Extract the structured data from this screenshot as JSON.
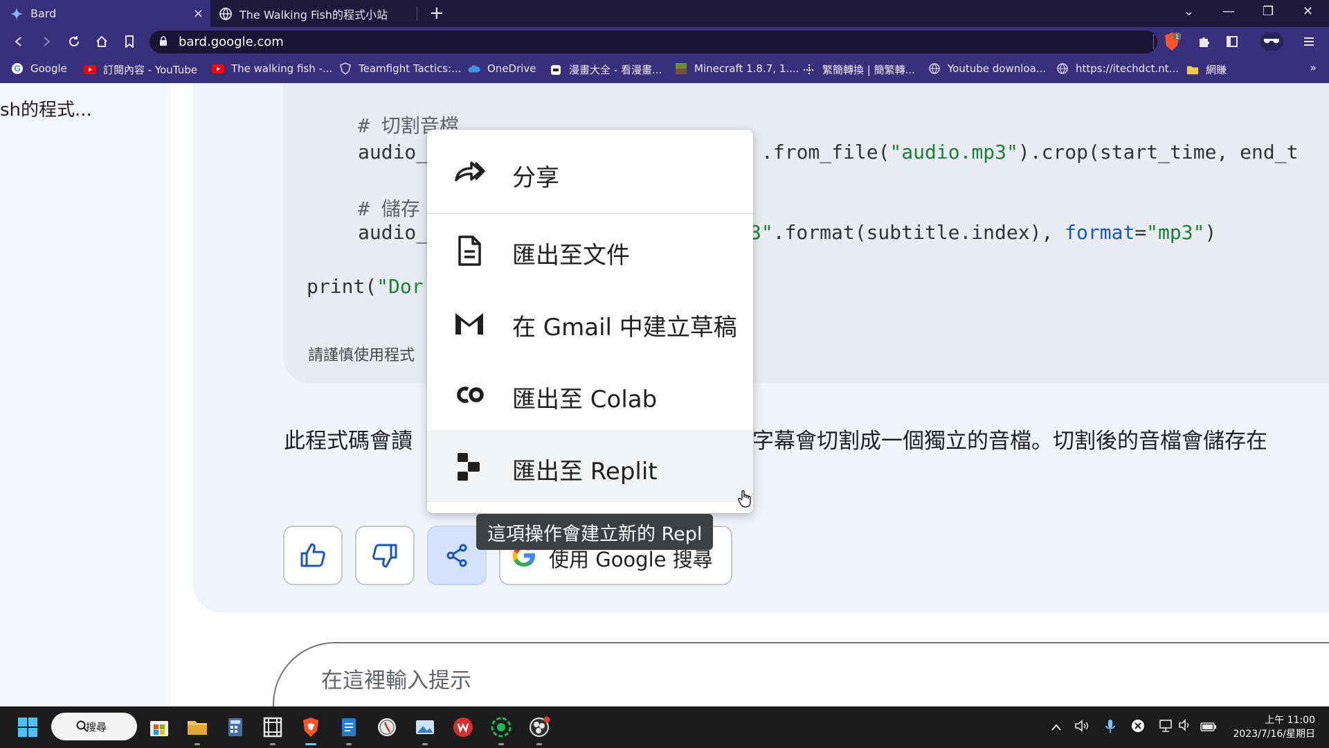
{
  "tabs": [
    {
      "title": "Bard",
      "close": "×"
    },
    {
      "title": "The Walking Fish的程式小站"
    }
  ],
  "newtab_label": "+",
  "window_controls": {
    "dropdown": "⌄",
    "minimize": "—",
    "restore": "❐",
    "close": "✕"
  },
  "address_bar": {
    "url": "bard.google.com"
  },
  "bookmarks": [
    {
      "label": "Google",
      "icon": "google-icon"
    },
    {
      "label": "訂閱內容 - YouTube",
      "icon": "youtube-icon"
    },
    {
      "label": "The walking fish -...",
      "icon": "youtube-icon"
    },
    {
      "label": "Teamfight Tactics:...",
      "icon": "shield-icon"
    },
    {
      "label": "OneDrive",
      "icon": "cloud-icon"
    },
    {
      "label": "漫畫大全 - 看漫畫...",
      "icon": "manga-icon"
    },
    {
      "label": "Minecraft 1.8.7, 1....",
      "icon": "minecraft-icon"
    },
    {
      "label": "繁簡轉換 | 簡繁轉...",
      "icon": "convert-icon"
    },
    {
      "label": "Youtube downloa...",
      "icon": "globe-icon"
    },
    {
      "label": "https://itechdct.nt...",
      "icon": "globe-icon"
    },
    {
      "label": "網賺",
      "icon": "folder-icon"
    }
  ],
  "bookmarks_more": "»",
  "sidebar": {
    "conversation_title": "sh的程式..."
  },
  "code": {
    "comment1": "# 切割音檔",
    "line_a_left": "audio_",
    "line_a_right_prefix": ".from_file(",
    "line_a_right_str": "\"audio.mp3\"",
    "line_a_right_suffix": ").crop(start_time, end_t",
    "comment2": "# 儲存",
    "line_b_left": "audio_",
    "line_b_right_str": "3\"",
    "line_b_right_mid": ".format(subtitle.index), ",
    "line_b_right_kw": "format",
    "line_b_right_eq": "=",
    "line_b_right_str2": "\"mp3\"",
    "line_b_right_end": ")",
    "print_prefix": "print(",
    "print_str": "\"Dor"
  },
  "caution_text": "請謹慎使用程式",
  "answer_text_left": "此程式碼會讀",
  "answer_text_right": "字幕會切割成一個獨立的音檔。切割後的音檔會儲存在",
  "share_menu": {
    "items": [
      {
        "label": "分享",
        "icon": "share-arrow-icon"
      },
      {
        "label": "匯出至文件",
        "icon": "document-icon"
      },
      {
        "label": "在 Gmail 中建立草稿",
        "icon": "gmail-icon"
      },
      {
        "label": "匯出至 Colab",
        "icon": "colab-icon"
      },
      {
        "label": "匯出至 Replit",
        "icon": "replit-icon"
      }
    ]
  },
  "tooltip": "這項操作會建立新的 Repl",
  "google_search_button": "使用 Google 搜尋",
  "prompt": {
    "placeholder": "在這裡輸入提示"
  },
  "taskbar": {
    "search_label": "搜尋",
    "clock_time": "上午 11:00",
    "clock_date": "2023/7/16/星期日"
  },
  "colors": {
    "tab_strip": "#1f1a3d",
    "toolbar": "#3a2f7a",
    "share_active": "#d3e3fd",
    "code_string": "#188038",
    "code_keyword": "#1a55b8"
  }
}
